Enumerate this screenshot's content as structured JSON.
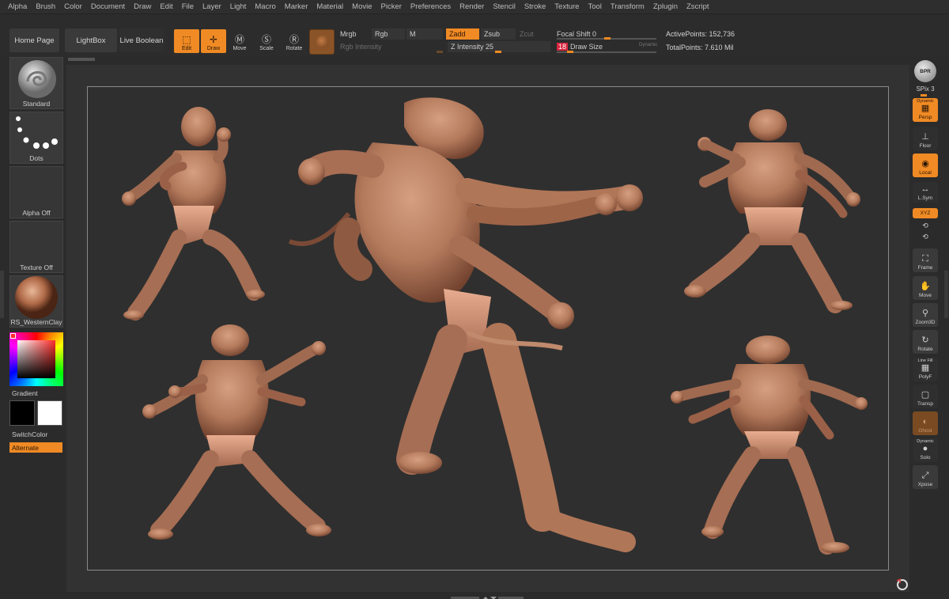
{
  "menu": [
    "Alpha",
    "Brush",
    "Color",
    "Document",
    "Draw",
    "Edit",
    "File",
    "Layer",
    "Light",
    "Macro",
    "Marker",
    "Material",
    "Movie",
    "Picker",
    "Preferences",
    "Render",
    "Stencil",
    "Stroke",
    "Texture",
    "Tool",
    "Transform",
    "Zplugin",
    "Zscript"
  ],
  "toolbar": {
    "home_page": "Home Page",
    "lightbox": "LightBox",
    "live_boolean": "Live Boolean",
    "edit": "Edit",
    "draw": "Draw",
    "move": "Move",
    "scale": "Scale",
    "rotate": "Rotate",
    "mrgb": "Mrgb",
    "rgb": "Rgb",
    "m": "M",
    "rgb_intensity": "Rgb Intensity",
    "zadd": "Zadd",
    "zsub": "Zsub",
    "zcut": "Zcut",
    "z_intensity": "Z Intensity 25",
    "focal_shift": "Focal Shift 0",
    "draw_size_value": "18",
    "draw_size": "Draw Size",
    "dynamic": "Dynamic",
    "active_points": "ActivePoints: 152,736",
    "total_points": "TotalPoints: 7.610 Mil"
  },
  "left": {
    "brush": "Standard",
    "stroke": "Dots",
    "alpha": "Alpha Off",
    "texture": "Texture Off",
    "material": "RS_WesternClay",
    "gradient": "Gradient",
    "switch_color": "SwitchColor",
    "alternate": "Alternate"
  },
  "right": {
    "bpr": "BPR",
    "spix": "SPix 3",
    "dynamic": "Dynamic",
    "persp": "Persp",
    "floor": "Floor",
    "local": "Local",
    "lsym": "L.Sym",
    "xyz": "XYZ",
    "frame": "Frame",
    "move": "Move",
    "zoom3d": "Zoom3D",
    "rotate": "Rotate",
    "line_fill": "Line Fill",
    "polyf": "PolyF",
    "transp": "Transp",
    "ghost": "Ghost",
    "dynamic2": "Dynamic",
    "solo": "Solo",
    "xpose": "Xpose"
  },
  "colors": {
    "accent": "#f08a24",
    "clay": "#b57b5e",
    "clay_dark": "#7a4a36"
  }
}
